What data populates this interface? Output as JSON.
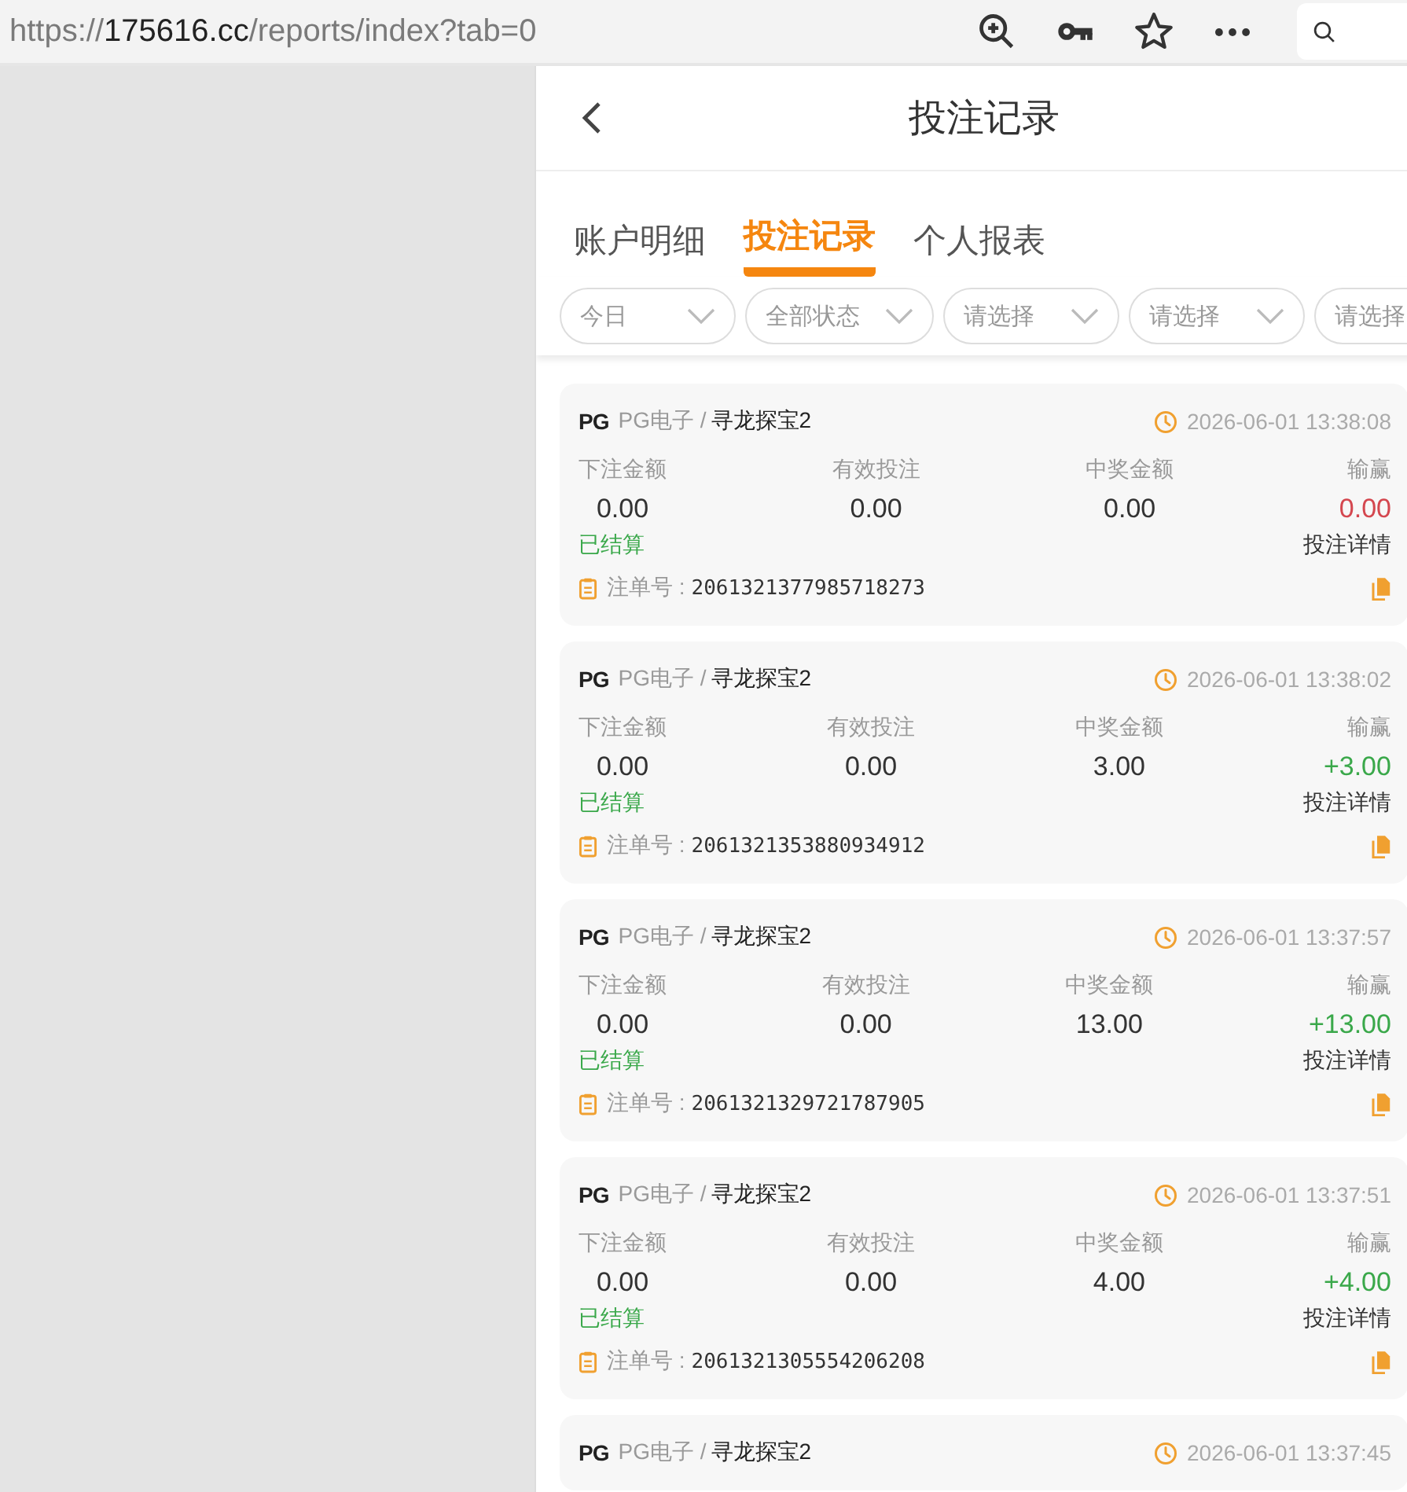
{
  "browser": {
    "url": {
      "scheme": "https://",
      "host": "175616.cc",
      "path": "/reports/index?tab=0"
    }
  },
  "header": {
    "title": "投注记录"
  },
  "tabs": [
    {
      "label": "账户明细",
      "selected": false
    },
    {
      "label": "投注记录",
      "selected": true
    },
    {
      "label": "个人报表",
      "selected": false
    }
  ],
  "filters": [
    {
      "label": "今日"
    },
    {
      "label": "全部状态"
    },
    {
      "label": "请选择"
    },
    {
      "label": "请选择"
    },
    {
      "label": "请选择"
    }
  ],
  "records": [
    {
      "logo": "PG",
      "provider": "PG电子 /",
      "game": "寻龙探宝2",
      "time": "2026-06-01 13:38:08",
      "fields": [
        {
          "label": "下注金额",
          "value": "0.00"
        },
        {
          "label": "有效投注",
          "value": "0.00"
        },
        {
          "label": "中奖金额",
          "value": "0.00"
        },
        {
          "label": "输赢",
          "value": "0.00"
        }
      ],
      "color": "#d4474f",
      "status": "已结算",
      "detail_link": "投注详情",
      "order_label": "注单号 :",
      "order_no": "2061321377985718273"
    },
    {
      "logo": "PG",
      "provider": "PG电子 /",
      "game": "寻龙探宝2",
      "time": "2026-06-01 13:38:02",
      "fields": [
        {
          "label": "下注金额",
          "value": "0.00"
        },
        {
          "label": "有效投注",
          "value": "0.00"
        },
        {
          "label": "中奖金额",
          "value": "3.00"
        },
        {
          "label": "输赢",
          "value": "+3.00"
        }
      ],
      "color": "#3aa84a",
      "status": "已结算",
      "detail_link": "投注详情",
      "order_label": "注单号 :",
      "order_no": "2061321353880934912"
    },
    {
      "logo": "PG",
      "provider": "PG电子 /",
      "game": "寻龙探宝2",
      "time": "2026-06-01 13:37:57",
      "fields": [
        {
          "label": "下注金额",
          "value": "0.00"
        },
        {
          "label": "有效投注",
          "value": "0.00"
        },
        {
          "label": "中奖金额",
          "value": "13.00"
        },
        {
          "label": "输赢",
          "value": "+13.00"
        }
      ],
      "color": "#3aa84a",
      "status": "已结算",
      "detail_link": "投注详情",
      "order_label": "注单号 :",
      "order_no": "2061321329721787905"
    },
    {
      "logo": "PG",
      "provider": "PG电子 /",
      "game": "寻龙探宝2",
      "time": "2026-06-01 13:37:51",
      "fields": [
        {
          "label": "下注金额",
          "value": "0.00"
        },
        {
          "label": "有效投注",
          "value": "0.00"
        },
        {
          "label": "中奖金额",
          "value": "4.00"
        },
        {
          "label": "输赢",
          "value": "+4.00"
        }
      ],
      "color": "#3aa84a",
      "status": "已结算",
      "detail_link": "投注详情",
      "order_label": "注单号 :",
      "order_no": "2061321305554206208"
    },
    {
      "logo": "PG",
      "provider": "PG电子 /",
      "game": "寻龙探宝2",
      "time": "2026-06-01 13:37:45"
    }
  ]
}
